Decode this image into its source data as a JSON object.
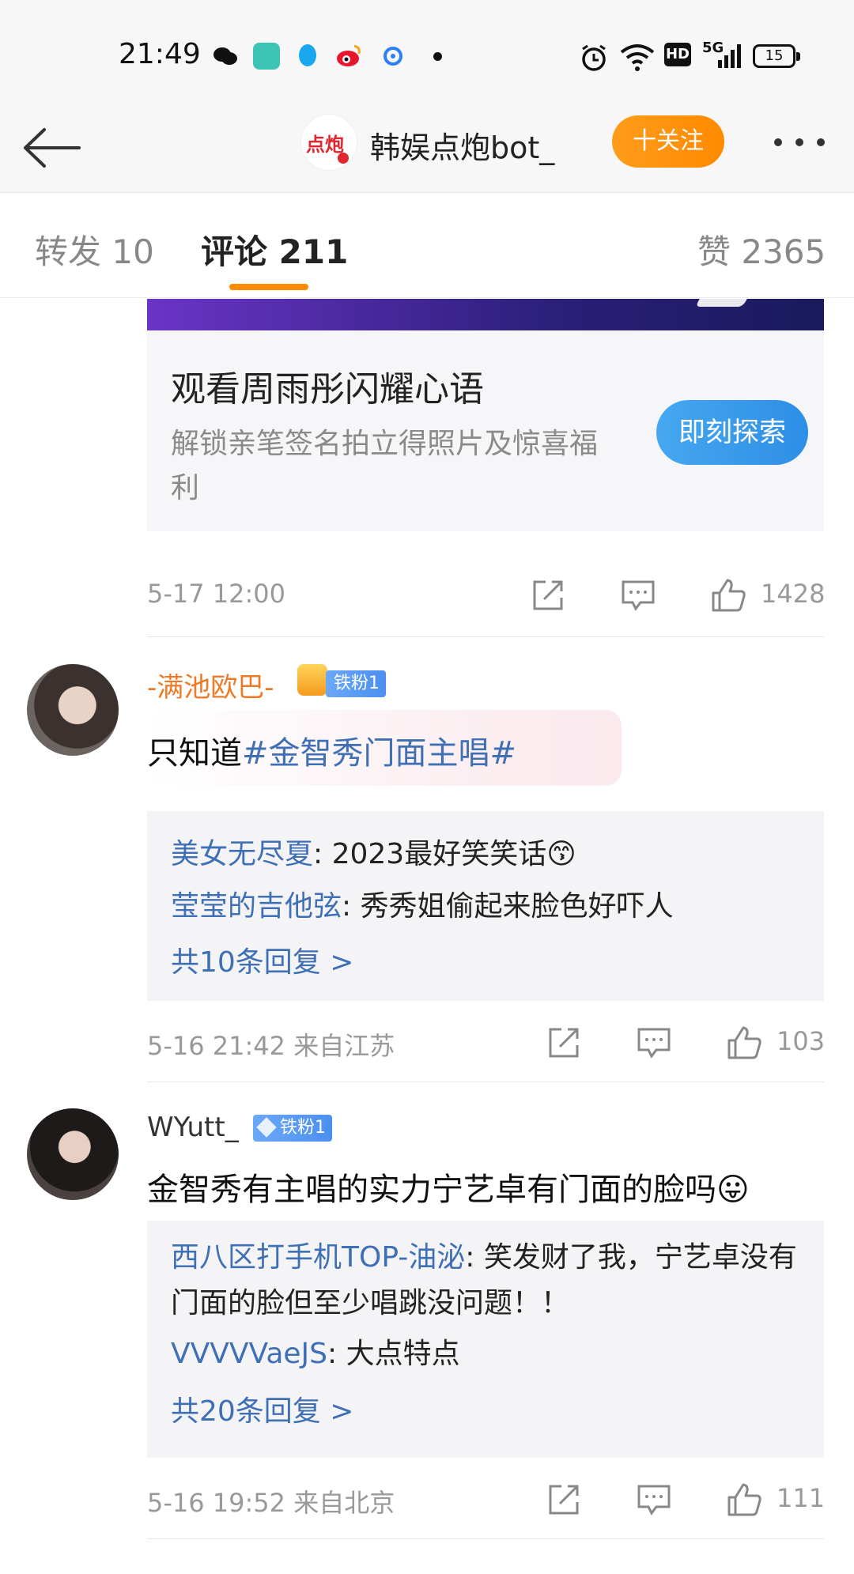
{
  "status_bar": {
    "time": "21:49",
    "network": "5G",
    "hd": "HD",
    "battery": "15"
  },
  "header": {
    "logo_text": "点炮",
    "account_name": "韩娱点炮bot_",
    "follow_label": "十关注"
  },
  "tabs": {
    "repost": "转发 10",
    "comments": "评论 211",
    "likes": "赞 2365"
  },
  "promo": {
    "title": "观看周雨彤闪耀心语",
    "subtitle": "解锁亲笔签名拍立得照片及惊喜福利",
    "button": "即刻探索"
  },
  "post_actions": {
    "time": "5-17 12:00",
    "likes": "1428"
  },
  "comments": [
    {
      "user": "-满池欧巴-",
      "badge": "铁粉1",
      "text_prefix": "只知道",
      "hashtag": "#金智秀门面主唱#",
      "replies": [
        {
          "name": "美女无尽夏",
          "text": ": 2023最好笑笑话😙"
        },
        {
          "name": "莹莹的吉他弦",
          "text": ": 秀秀姐偷起来脸色好吓人"
        }
      ],
      "more": "共10条回复 >",
      "meta": "5-16 21:42 来自江苏",
      "likes": "103"
    },
    {
      "user": "WYutt_",
      "badge": "铁粉1",
      "text": "金智秀有主唱的实力宁艺卓有门面的脸吗😛",
      "replies": [
        {
          "name": "西八区打手机TOP-油泌",
          "text": ": 笑发财了我，宁艺卓没有门面的脸但至少唱跳没问题！！"
        },
        {
          "name": "VVVVVaeJS",
          "text": ": 大点特点"
        }
      ],
      "more": "共20条回复 >",
      "meta": "5-16 19:52 来自北京",
      "likes": "111"
    }
  ],
  "colors": {
    "accent": "#ff8a00",
    "link": "#3f6fb5",
    "muted": "#999999"
  }
}
